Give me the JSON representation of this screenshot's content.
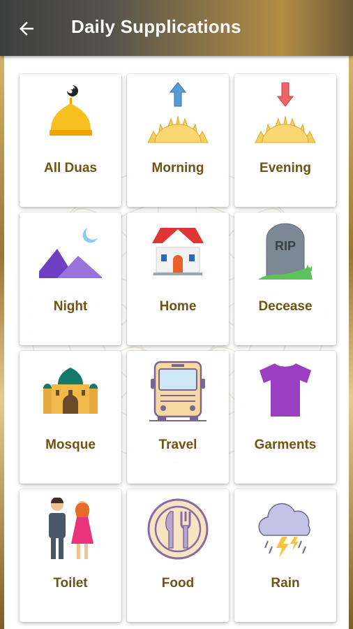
{
  "appbar": {
    "title": "Daily Supplications",
    "back_icon": "arrow-left-icon"
  },
  "categories": [
    {
      "label": "All Duas",
      "icon": "mosque-dome-icon"
    },
    {
      "label": "Morning",
      "icon": "sunrise-icon"
    },
    {
      "label": "Evening",
      "icon": "sunset-icon"
    },
    {
      "label": "Night",
      "icon": "mountains-moon-icon"
    },
    {
      "label": "Home",
      "icon": "house-icon"
    },
    {
      "label": "Decease",
      "icon": "gravestone-icon"
    },
    {
      "label": "Mosque",
      "icon": "mosque-icon"
    },
    {
      "label": "Travel",
      "icon": "bus-icon"
    },
    {
      "label": "Garments",
      "icon": "tshirt-icon"
    },
    {
      "label": "Toilet",
      "icon": "man-woman-icon"
    },
    {
      "label": "Food",
      "icon": "plate-cutlery-icon"
    },
    {
      "label": "Rain",
      "icon": "rain-cloud-icon"
    }
  ],
  "gravestone_text": "RIP",
  "colors": {
    "label": "#6e5414",
    "appbar_dark": "#3e3f3f",
    "appbar_gold": "#b48d45"
  }
}
